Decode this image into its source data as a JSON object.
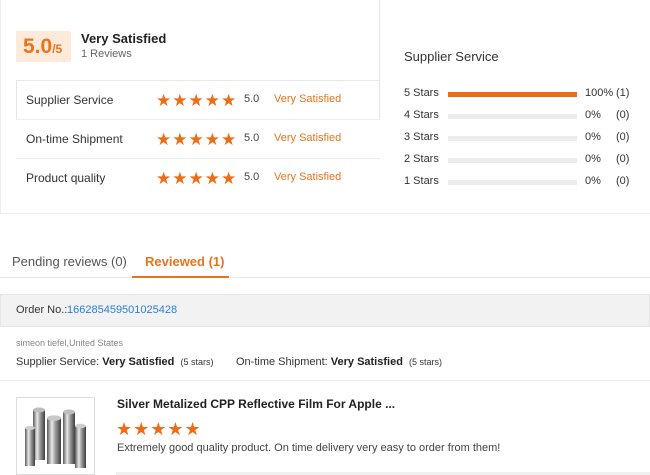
{
  "summary": {
    "score": "5.0",
    "score_max": "/5",
    "satisfaction": "Very Satisfied",
    "reviews_count": "1 Reviews",
    "ratings": [
      {
        "label": "Supplier Service",
        "stars": 5,
        "value": "5.0",
        "text": "Very Satisfied"
      },
      {
        "label": "On-time Shipment",
        "stars": 5,
        "value": "5.0",
        "text": "Very Satisfied"
      },
      {
        "label": "Product quality",
        "stars": 5,
        "value": "5.0",
        "text": "Very Satisfied"
      }
    ]
  },
  "supplier_service": {
    "title": "Supplier Service",
    "breakdown": [
      {
        "label": "5 Stars",
        "fraction": 1.0,
        "percent": "100%",
        "count": "(1)"
      },
      {
        "label": "4 Stars",
        "fraction": 0.0,
        "percent": "0%",
        "count": "(0)"
      },
      {
        "label": "3 Stars",
        "fraction": 0.0,
        "percent": "0%",
        "count": "(0)"
      },
      {
        "label": "2 Stars",
        "fraction": 0.0,
        "percent": "0%",
        "count": "(0)"
      },
      {
        "label": "1 Stars",
        "fraction": 0.0,
        "percent": "0%",
        "count": "(0)"
      }
    ]
  },
  "tabs": [
    {
      "label": "Pending reviews (0)",
      "active": false
    },
    {
      "label": "Reviewed (1)",
      "active": true
    }
  ],
  "order": {
    "label": "Order No.:",
    "number": "166285459501025428",
    "reviewer": "simeon tiefel,United States",
    "supplier_service_label": "Supplier Service:",
    "supplier_service_value": "Very Satisfied",
    "supplier_service_stars": "(5 stars)",
    "shipment_label": "On-time Shipment:",
    "shipment_value": "Very Satisfied",
    "shipment_stars": "(5 stars)"
  },
  "product": {
    "title": "Silver Metalized CPP Reflective Film For Apple ...",
    "stars": 5,
    "review": "Extremely good quality product. On time delivery very easy to order from them!",
    "thumbnail_icon": "film-rolls-image"
  },
  "colors": {
    "accent": "#e8741e",
    "star": "#ef6c16",
    "link": "#2a7fd4"
  }
}
